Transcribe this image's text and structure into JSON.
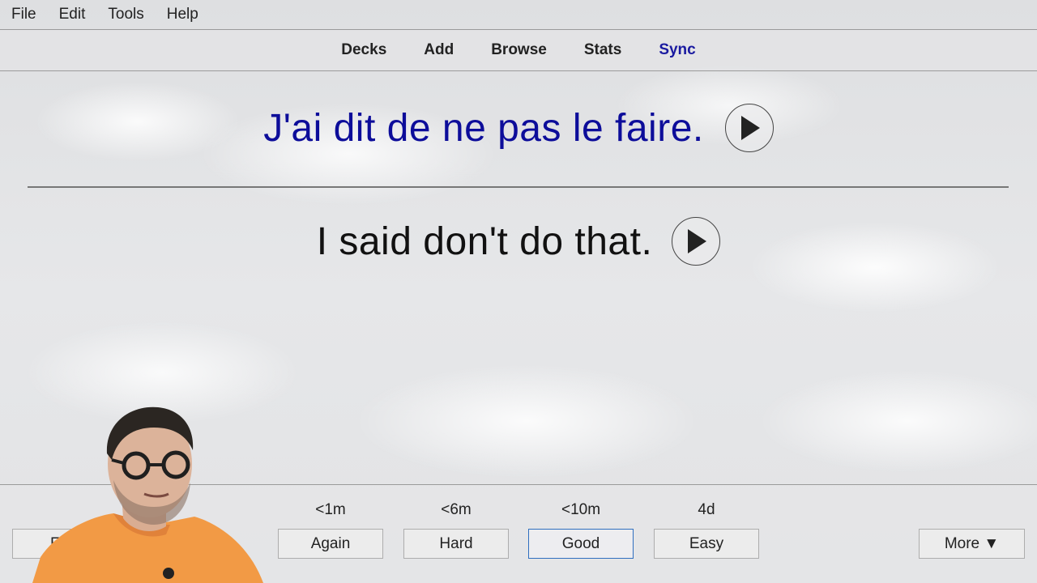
{
  "menu": [
    "File",
    "Edit",
    "Tools",
    "Help"
  ],
  "toolbar": {
    "decks": "Decks",
    "add": "Add",
    "browse": "Browse",
    "stats": "Stats",
    "sync": "Sync"
  },
  "card": {
    "front": "J'ai dit de ne pas le faire.",
    "back": "I said don't do that."
  },
  "answers": {
    "edit": "Edit",
    "again": {
      "label": "Again",
      "interval": "<1m"
    },
    "hard": {
      "label": "Hard",
      "interval": "<6m"
    },
    "good": {
      "label": "Good",
      "interval": "<10m"
    },
    "easy": {
      "label": "Easy",
      "interval": "4d"
    },
    "more": "More ▼"
  },
  "colors": {
    "front_text": "#0d0d9a",
    "sync_link": "#1a1aa0",
    "good_focus": "#2f6fbf"
  },
  "icons": [
    "play-icon",
    "play-icon"
  ]
}
